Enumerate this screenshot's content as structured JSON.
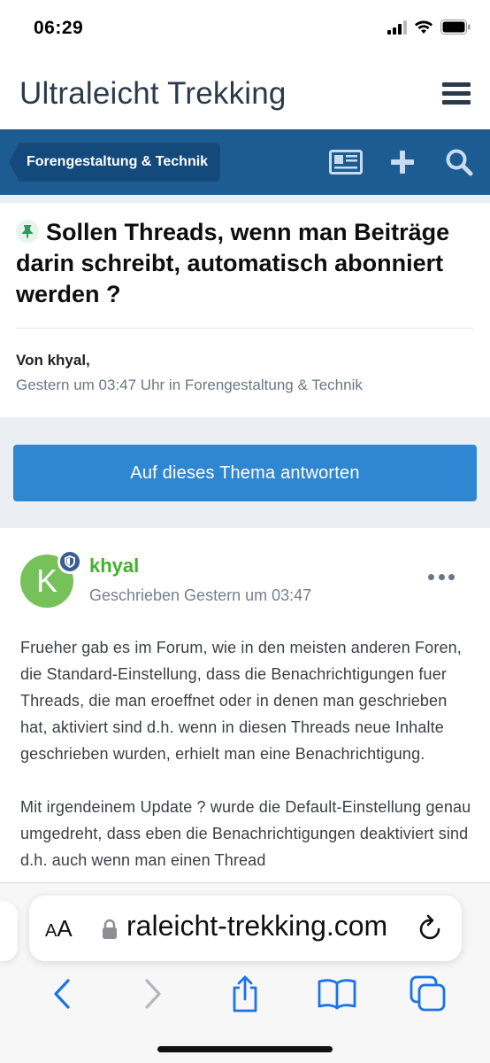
{
  "status_bar": {
    "time": "06:29"
  },
  "site": {
    "title": "Ultraleicht Trekking"
  },
  "nav": {
    "breadcrumb": "Forengestaltung & Technik"
  },
  "topic": {
    "title": "Sollen Threads, wenn man Beiträge darin schreibt, automatisch abonniert werden ?",
    "author_line": "Von khyal,",
    "meta_line": "Gestern um 03:47 Uhr in Forengestaltung & Technik"
  },
  "reply_button": {
    "label": "Auf dieses Thema antworten"
  },
  "post": {
    "avatar_letter": "K",
    "author": "khyal",
    "date": "Geschrieben Gestern um 03:47",
    "paragraphs": [
      "Frueher gab es im Forum, wie in den meisten anderen Foren, die Standard-Einstellung, dass die Benachrichtigungen fuer Threads, die man eroeffnet oder in denen man geschrieben hat, aktiviert sind d.h. wenn in diesen Threads neue Inhalte geschrieben wurden, erhielt man eine Benachrichtigung.",
      "Mit irgendeinem Update ? wurde die Default-Einstellung genau umgedreht, dass eben die Benachrichtigungen deaktiviert sind d.h. auch wenn man einen Thread"
    ]
  },
  "browser": {
    "aa_label_small": "A",
    "aa_label_big": "A",
    "url": "raleicht-trekking.com"
  },
  "icons": {
    "status": [
      "signal-icon",
      "wifi-icon",
      "battery-icon"
    ],
    "nav": [
      "newspaper-icon",
      "plus-icon",
      "search-icon"
    ],
    "toolbar": [
      "back-icon",
      "forward-icon",
      "share-icon",
      "bookmarks-icon",
      "tabs-icon"
    ]
  },
  "colors": {
    "nav_bar": "#1d5b93",
    "breadcrumb": "#144a7b",
    "reply_button": "#2f86d1",
    "author_green": "#41b22c",
    "avatar_green": "#77c15a",
    "safari_blue": "#1a73e8"
  }
}
